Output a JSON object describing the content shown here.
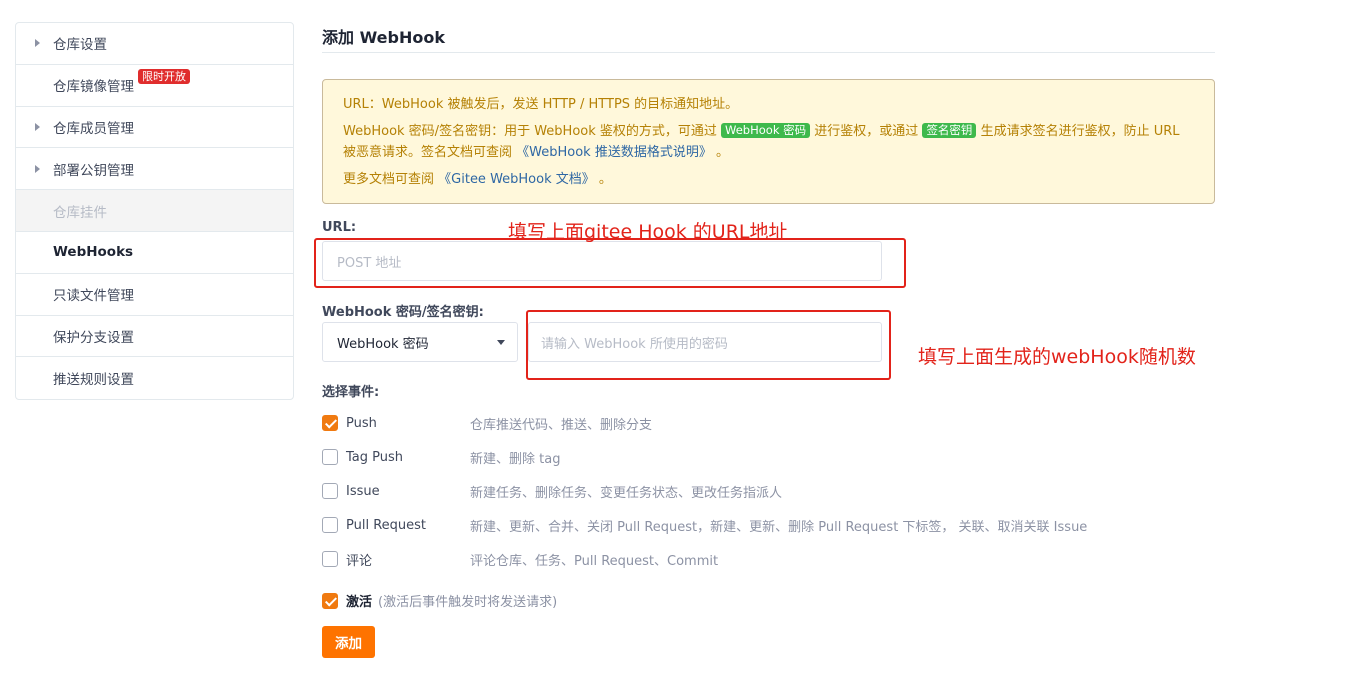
{
  "sidebar": {
    "items": [
      {
        "label": "仓库设置",
        "caret": true,
        "state": "normal"
      },
      {
        "label": "仓库镜像管理",
        "caret": false,
        "state": "normal",
        "badge": "限时开放"
      },
      {
        "label": "仓库成员管理",
        "caret": true,
        "state": "normal"
      },
      {
        "label": "部署公钥管理",
        "caret": true,
        "state": "normal"
      },
      {
        "label": "仓库挂件",
        "caret": false,
        "state": "disabled"
      },
      {
        "label": "WebHooks",
        "caret": false,
        "state": "active"
      },
      {
        "label": "只读文件管理",
        "caret": false,
        "state": "normal"
      },
      {
        "label": "保护分支设置",
        "caret": false,
        "state": "normal"
      },
      {
        "label": "推送规则设置",
        "caret": false,
        "state": "normal"
      }
    ]
  },
  "page": {
    "title": "添加 WebHook"
  },
  "notice": {
    "line1": "URL：WebHook 被触发后，发送 HTTP / HTTPS 的目标通知地址。",
    "line2_a": "WebHook 密码/签名密钥：用于 WebHook 鉴权的方式，可通过",
    "tag1": "WebHook 密码",
    "line2_b": "进行鉴权，或通过",
    "tag2": "签名密钥",
    "line2_c": "生成请求签名进行鉴权，防止 URL 被恶意请求。签名文档可查阅",
    "link1": "《WebHook 推送数据格式说明》",
    "line2_d": "。",
    "line3_a": "更多文档可查阅",
    "link2": "《Gitee WebHook 文档》",
    "line3_b": "。"
  },
  "form": {
    "url_label": "URL:",
    "url_placeholder": "POST 地址",
    "secret_label": "WebHook 密码/签名密钥:",
    "secret_type": "WebHook 密码",
    "secret_placeholder": "请输入 WebHook 所使用的密码",
    "events_label": "选择事件:",
    "events": [
      {
        "name": "Push",
        "desc": "仓库推送代码、推送、删除分支",
        "checked": true
      },
      {
        "name": "Tag Push",
        "desc": "新建、删除 tag",
        "checked": false
      },
      {
        "name": "Issue",
        "desc": "新建任务、删除任务、变更任务状态、更改任务指派人",
        "checked": false
      },
      {
        "name": "Pull Request",
        "desc": "新建、更新、合并、关闭 Pull Request，新建、更新、删除 Pull Request 下标签， 关联、取消关联 Issue",
        "checked": false
      },
      {
        "name": "评论",
        "desc": "评论仓库、任务、Pull Request、Commit",
        "checked": false
      }
    ],
    "active_label": "激活",
    "active_hint": "(激活后事件触发时将发送请求)",
    "active_checked": true,
    "submit_label": "添加"
  },
  "annotations": {
    "url_note": "填写上面gitee Hook 的URL地址",
    "secret_note": "填写上面生成的webHook随机数"
  },
  "colors": {
    "accent": "#fe7300",
    "checkbox": "#f07a10",
    "notice_bg": "#fff8db",
    "notice_text": "#b58105",
    "tag_green": "#3eb94c",
    "badge_red": "#e02d2d",
    "annotation_red": "#e2231a"
  }
}
